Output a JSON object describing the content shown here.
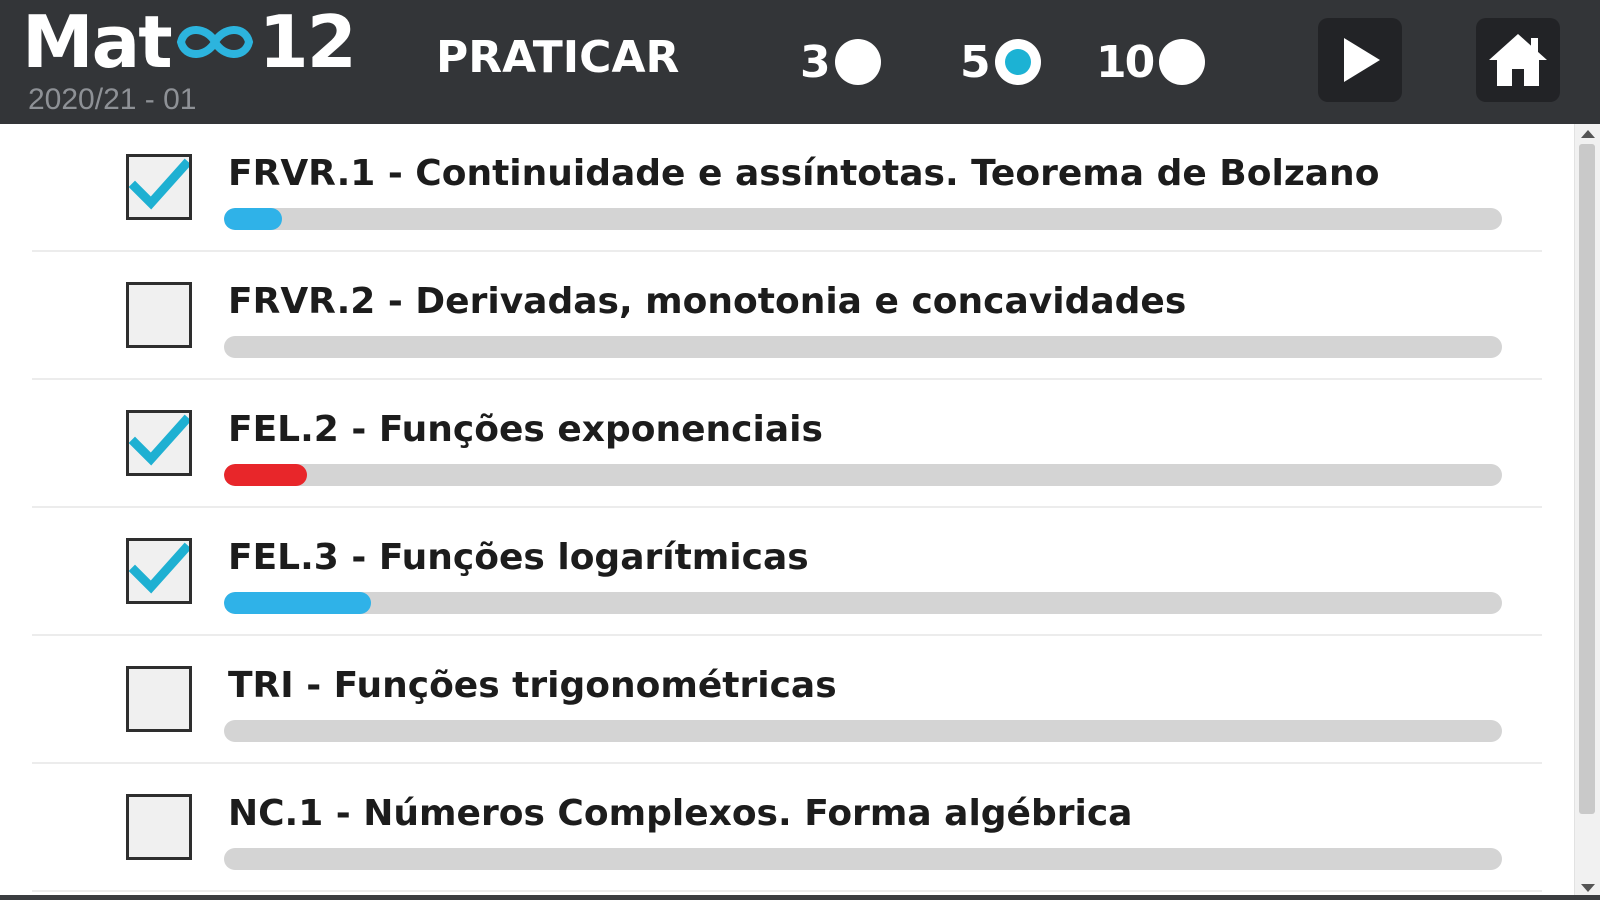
{
  "header": {
    "logo_left": "Mat",
    "logo_right": "12",
    "logo_subtitle": "2020/21 - 01",
    "mode_title": "PRATICAR",
    "count_options": [
      {
        "label": "3",
        "selected": false
      },
      {
        "label": "5",
        "selected": true
      },
      {
        "label": "10",
        "selected": false
      }
    ],
    "play_icon": "play-icon",
    "home_icon": "home-icon"
  },
  "colors": {
    "topbar": "#333538",
    "accent": "#1cb2d4",
    "progress_blue": "#2fb2e8",
    "progress_red": "#e8262a",
    "track": "#d4d4d4"
  },
  "topics": [
    {
      "label": "FRVR.1 - Continuidade e assíntotas. Teorema de Bolzano",
      "checked": true,
      "progress": 0.045,
      "progress_color": "#2fb2e8"
    },
    {
      "label": "FRVR.2 - Derivadas, monotonia e concavidades",
      "checked": false,
      "progress": 0,
      "progress_color": "#2fb2e8"
    },
    {
      "label": "FEL.2 - Funções exponenciais",
      "checked": true,
      "progress": 0.065,
      "progress_color": "#e8262a"
    },
    {
      "label": "FEL.3 - Funções logarítmicas",
      "checked": true,
      "progress": 0.115,
      "progress_color": "#2fb2e8"
    },
    {
      "label": "TRI - Funções trigonométricas",
      "checked": false,
      "progress": 0,
      "progress_color": "#2fb2e8"
    },
    {
      "label": "NC.1 - Números Complexos. Forma algébrica",
      "checked": false,
      "progress": 0,
      "progress_color": "#2fb2e8"
    }
  ]
}
